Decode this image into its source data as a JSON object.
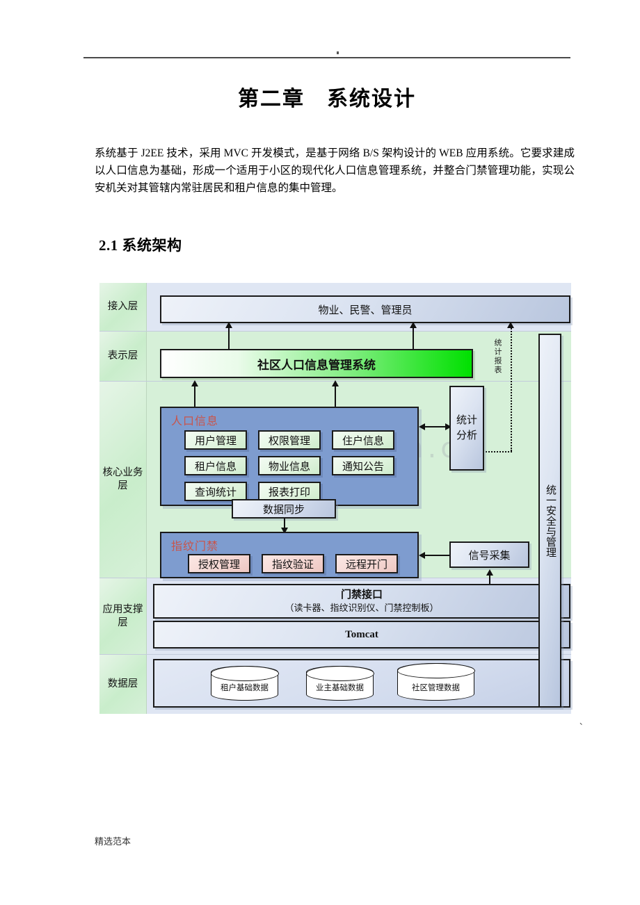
{
  "document": {
    "chapter_title": "第二章　系统设计",
    "intro_paragraph": "系统基于 J2EE 技术，采用 MVC 开发模式，是基于网络 B/S 架构设计的 WEB 应用系统。它要求建成以人口信息为基础，形成一个适用于小区的现代化人口信息管理系统，并整合门禁管理功能，实现公安机关对其管辖内常驻居民和租户信息的集中管理。",
    "section_heading": "2.1 系统架构",
    "footer_text": "精选范本",
    "corner_mark": "、",
    "watermark": "www.zixin.com.cn"
  },
  "diagram": {
    "layers": [
      {
        "id": "access",
        "label": "接入层"
      },
      {
        "id": "presentation",
        "label": "表示层"
      },
      {
        "id": "core",
        "label": "核心业务层"
      },
      {
        "id": "support",
        "label": "应用支撑层"
      },
      {
        "id": "data",
        "label": "数据层"
      }
    ],
    "access_box": "物业、民警、管理员",
    "presentation_bar": "社区人口信息管理系统",
    "population_panel": {
      "title": "人口信息",
      "modules": [
        "用户管理",
        "权限管理",
        "住户信息",
        "租户信息",
        "物业信息",
        "通知公告",
        "查询统计",
        "报表打印"
      ]
    },
    "stats_box": "统计\n分析",
    "stats_box_line1": "统计",
    "stats_box_line2": "分析",
    "report_flow_label": "统计报表",
    "sync_box": "数据同步",
    "access_control_panel": {
      "title": "指纹门禁",
      "modules": [
        "授权管理",
        "指纹验证",
        "远程开门"
      ]
    },
    "signal_box": "信号采集",
    "interface_box": {
      "title": "门禁接口",
      "subtitle": "（读卡器、指纹识别仪、门禁控制板）"
    },
    "tomcat_box": "Tomcat",
    "databases": [
      "租户基础数据",
      "业主基础数据",
      "社区管理数据"
    ],
    "security_bar": "统一安全与管理",
    "colors": {
      "layer_label_green": "#c9edcb",
      "panel_blue": "#7e9ccf",
      "chip_green": "#e2f4e0",
      "chip_pink": "#f4d6d2",
      "accent_red": "#c9544a",
      "bright_green": "#00e000",
      "box_gray": "#dbe3f1"
    }
  }
}
